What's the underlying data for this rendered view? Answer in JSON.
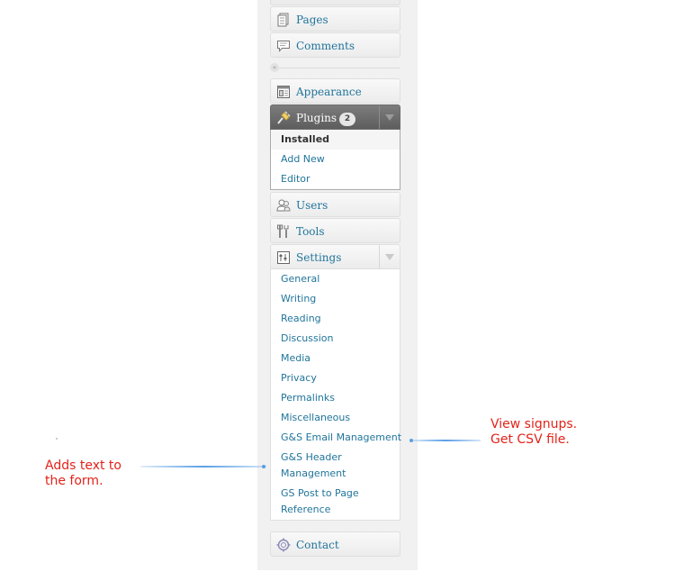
{
  "menu": {
    "pages": {
      "label": "Pages",
      "icon": "pages-icon"
    },
    "comments": {
      "label": "Comments",
      "icon": "comments-icon"
    },
    "collapse": {
      "glyph": "«"
    },
    "appearance": {
      "label": "Appearance",
      "icon": "appearance-icon"
    },
    "plugins": {
      "label": "Plugins",
      "badge": "2",
      "icon": "plugins-icon",
      "submenu": [
        "Installed",
        "Add New",
        "Editor"
      ],
      "current": "Installed"
    },
    "users": {
      "label": "Users",
      "icon": "users-icon"
    },
    "tools": {
      "label": "Tools",
      "icon": "tools-icon"
    },
    "settings": {
      "label": "Settings",
      "icon": "settings-icon",
      "submenu": [
        "General",
        "Writing",
        "Reading",
        "Discussion",
        "Media",
        "Privacy",
        "Permalinks",
        "Miscellaneous",
        "G&S Email Management",
        "G&S Header Management",
        "GS Post to Page Reference"
      ]
    },
    "contact": {
      "label": "Contact",
      "icon": "contact-icon"
    }
  },
  "annotations": {
    "left_text": "Adds text to\nthe form.",
    "right_text": "View signups.\nGet CSV file."
  },
  "colors": {
    "link": "#21759b",
    "annotation": "#e2231a",
    "arrow": "#5aa0e6",
    "active_menu": "#6d6d6d"
  }
}
